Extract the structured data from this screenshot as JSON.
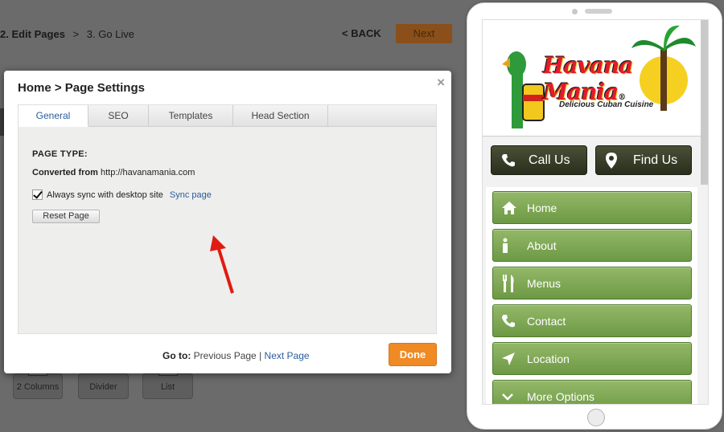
{
  "wizard": {
    "step2": "2. Edit Pages",
    "separator": ">",
    "step3": "3. Go Live",
    "back_label": "< BACK",
    "next_label": "Next"
  },
  "tools": {
    "columns_label": "2 Columns",
    "divider_label": "Divider",
    "list_label": "List"
  },
  "modal": {
    "title": "Home > Page Settings",
    "close_glyph": "×",
    "tabs": [
      {
        "label": "General",
        "active": true
      },
      {
        "label": "SEO",
        "active": false
      },
      {
        "label": "Templates",
        "active": false
      },
      {
        "label": "Head Section",
        "active": false
      }
    ],
    "page_type_label": "PAGE TYPE:",
    "converted_label": "Converted from",
    "converted_url": "http://havanamania.com",
    "sync_label": "Always sync with desktop site",
    "sync_checked": true,
    "sync_link": "Sync page",
    "reset_label": "Reset Page",
    "goto_label": "Go to:",
    "prev_link": "Previous Page",
    "divider": "|",
    "next_link": "Next Page",
    "done_label": "Done",
    "done_color": "#f08a24"
  },
  "phone": {
    "logo_title": "Havana Mania",
    "logo_registered": "®",
    "logo_tagline": "Delicious Cuban Cuisine",
    "top_buttons": [
      {
        "label": "Call Us",
        "icon": "phone-icon"
      },
      {
        "label": "Find Us",
        "icon": "map-pin-icon"
      }
    ],
    "menu": [
      {
        "label": "Home",
        "icon": "home-icon"
      },
      {
        "label": "About",
        "icon": "info-icon"
      },
      {
        "label": "Menus",
        "icon": "fork-knife-icon"
      },
      {
        "label": "Contact",
        "icon": "phone-icon"
      },
      {
        "label": "Location",
        "icon": "location-arrow-icon"
      },
      {
        "label": "More Options",
        "icon": "chevron-down-icon"
      }
    ],
    "accent_green": "#7aa44f"
  }
}
